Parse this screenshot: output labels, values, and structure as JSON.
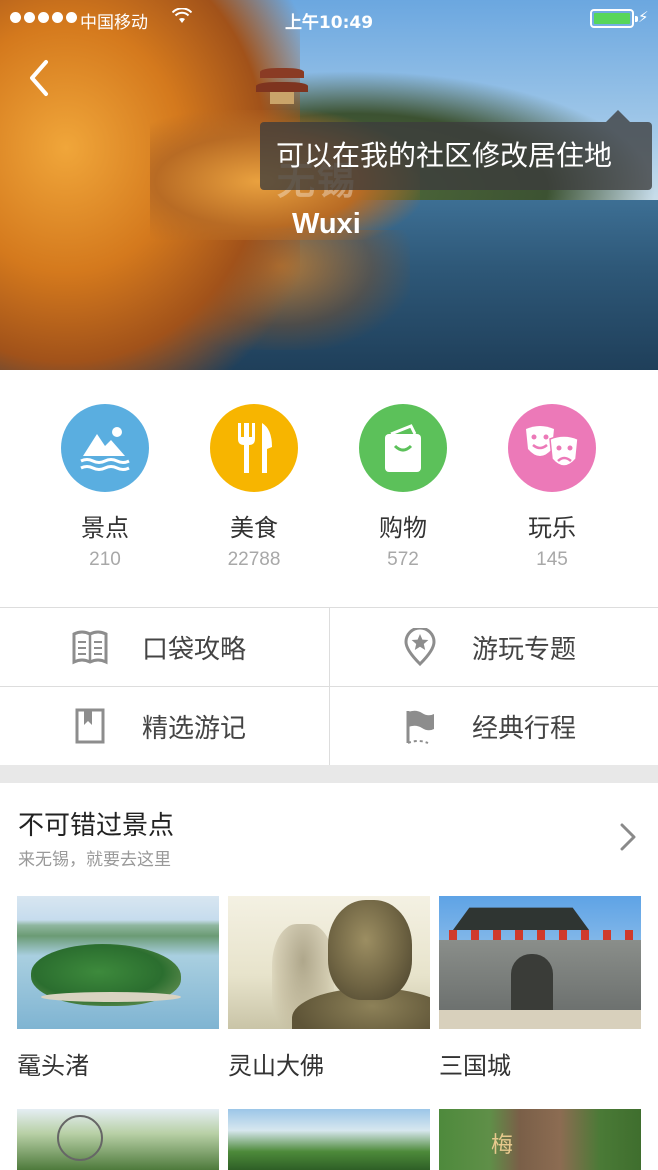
{
  "status_bar": {
    "carrier": "中国移动",
    "time": "上午10:49",
    "wifi_icon": "wifi-icon",
    "battery_icon": "battery-icon"
  },
  "hero": {
    "city_cn": "无锡",
    "city_en": "Wuxi",
    "tooltip": "可以在我的社区修改居住地",
    "back_icon": "back-arrow-icon"
  },
  "categories": [
    {
      "label": "景点",
      "count": "210",
      "color": "#5aaee0",
      "icon": "mountain-icon"
    },
    {
      "label": "美食",
      "count": "22788",
      "color": "#f7b500",
      "icon": "fork-knife-icon"
    },
    {
      "label": "购物",
      "count": "572",
      "color": "#5cc15a",
      "icon": "shopping-bag-icon"
    },
    {
      "label": "玩乐",
      "count": "145",
      "color": "#ec79b8",
      "icon": "masks-icon"
    }
  ],
  "guides": [
    {
      "label": "口袋攻略",
      "icon": "book-icon"
    },
    {
      "label": "游玩专题",
      "icon": "location-star-icon"
    },
    {
      "label": "精选游记",
      "icon": "bookmark-icon"
    },
    {
      "label": "经典行程",
      "icon": "flag-icon"
    }
  ],
  "section": {
    "title": "不可错过景点",
    "subtitle": "来无锡，就要去这里",
    "more_icon": "chevron-right-icon",
    "spots": [
      {
        "name": "鼋头渚"
      },
      {
        "name": "灵山大佛"
      },
      {
        "name": "三国城"
      }
    ]
  }
}
